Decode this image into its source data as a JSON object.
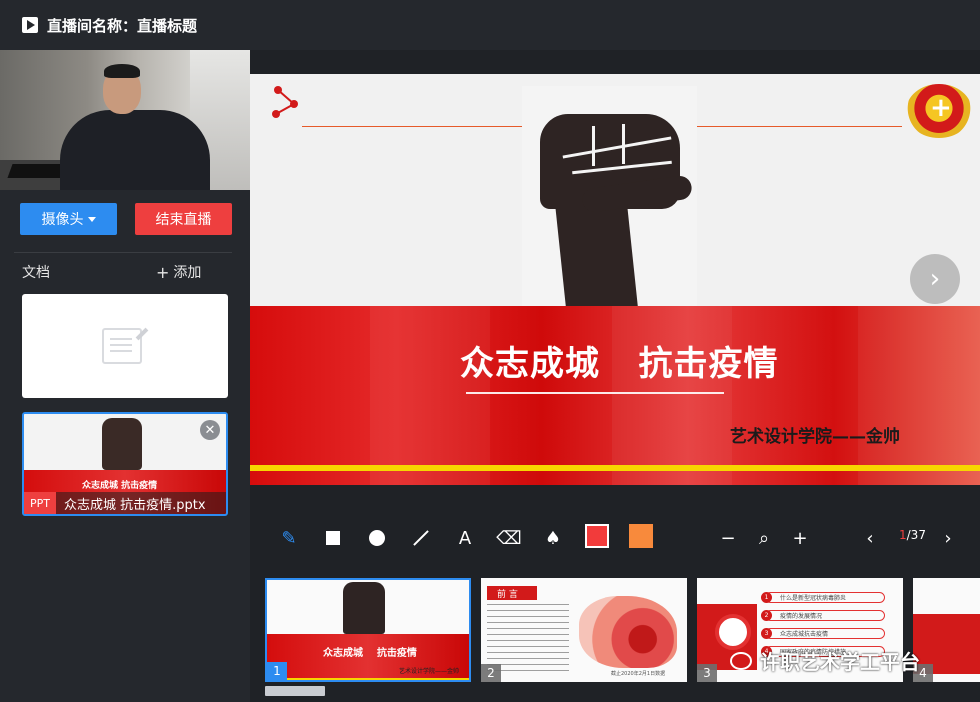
{
  "header": {
    "label": "直播间名称：",
    "title": "直播标题"
  },
  "sidebar": {
    "camera_button": "摄像头",
    "end_button": "结束直播",
    "doc_label": "文档",
    "add_label": "添加",
    "document": {
      "badge": "PPT",
      "name": "众志成城 抗击疫情.pptx",
      "mini_title": "众志成城    抗击疫情"
    }
  },
  "slide": {
    "title": "众志成城   抗击疫情",
    "subtitle": "艺术设计学院——金帅"
  },
  "toolbar": {
    "page_current": "1",
    "page_total": "/37",
    "colors": {
      "pen": "#f23b3b",
      "fill": "#f88a3c"
    }
  },
  "thumbnails": [
    {
      "num": "1",
      "title": "众志成城    抗击疫情",
      "sub": "艺术设计学院——金帅"
    },
    {
      "num": "2",
      "header": "前 言",
      "foot": "截止2020年2月1日数据"
    },
    {
      "num": "3",
      "items": [
        "什么是新型冠状病毒肺炎",
        "疫情的发展情况",
        "众志成城抗击疫情",
        "国家政府的疫情防控措施"
      ]
    },
    {
      "num": "4"
    }
  ],
  "watermark": "许职艺术学工平台"
}
